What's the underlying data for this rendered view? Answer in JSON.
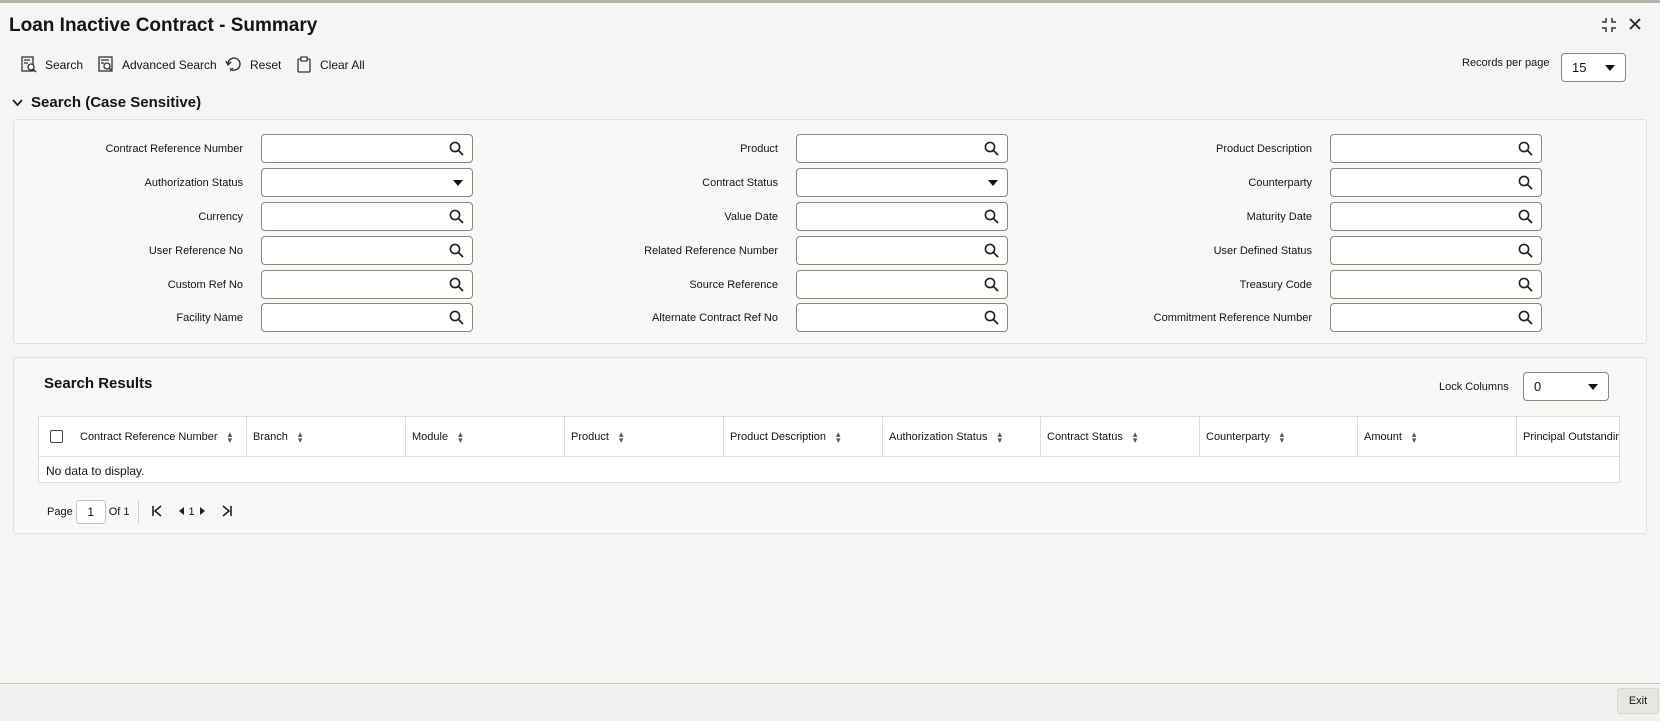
{
  "window": {
    "title": "Loan Inactive Contract - Summary"
  },
  "toolbar": {
    "search": "Search",
    "advanced_search": "Advanced Search",
    "reset": "Reset",
    "clear_all": "Clear All",
    "records_per_page_label": "Records per page",
    "records_per_page_value": "15"
  },
  "search_section": {
    "title": "Search (Case Sensitive)",
    "fields": {
      "contract_reference_number": "Contract Reference Number",
      "authorization_status": "Authorization Status",
      "currency": "Currency",
      "user_reference_no": "User Reference No",
      "custom_ref_no": "Custom Ref No",
      "facility_name": "Facility Name",
      "product": "Product",
      "contract_status": "Contract Status",
      "value_date": "Value Date",
      "related_reference_number": "Related Reference Number",
      "source_reference": "Source Reference",
      "alternate_contract_ref_no": "Alternate Contract Ref No",
      "product_description": "Product Description",
      "counterparty": "Counterparty",
      "maturity_date": "Maturity Date",
      "user_defined_status": "User Defined Status",
      "treasury_code": "Treasury Code",
      "commitment_reference_number": "Commitment Reference Number"
    }
  },
  "results": {
    "title": "Search Results",
    "lock_columns_label": "Lock Columns",
    "lock_columns_value": "0",
    "columns": [
      "Contract Reference Number",
      "Branch",
      "Module",
      "Product",
      "Product Description",
      "Authorization Status",
      "Contract Status",
      "Counterparty",
      "Amount",
      "Principal Outstanding"
    ],
    "empty_message": "No data to display.",
    "pager": {
      "page_label": "Page",
      "page_value": "1",
      "of_label": "Of 1",
      "current": "1"
    }
  },
  "footer": {
    "exit": "Exit"
  },
  "icons": {
    "search": "search-icon",
    "advanced_search": "advanced-search-icon",
    "reset": "reset-icon",
    "clear_all": "clipboard-icon",
    "lookup": "magnifier-icon",
    "expand": "chevron-down-icon",
    "maximize": "maximize-icon",
    "close": "close-icon"
  },
  "colors": {
    "background": "#f6f5f3",
    "panel": "#f9f8f6",
    "border": "#8a8680",
    "text": "#161513"
  }
}
